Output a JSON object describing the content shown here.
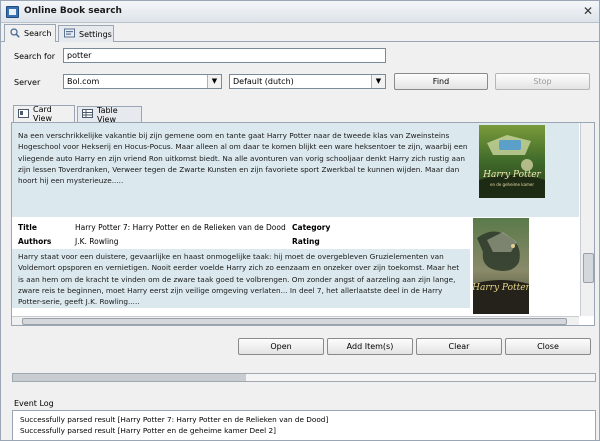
{
  "window": {
    "title": "Online Book search"
  },
  "tabs": [
    {
      "label": "Search"
    },
    {
      "label": "Settings"
    }
  ],
  "search": {
    "label": "Search for",
    "value": "potter"
  },
  "server": {
    "label": "Server",
    "value": "Bol.com",
    "locale": "Default (dutch)"
  },
  "buttons": {
    "find": "Find",
    "stop": "Stop",
    "open": "Open",
    "add": "Add Item(s)",
    "clear": "Clear",
    "close": "Close"
  },
  "view_tabs": [
    {
      "label": "Card View"
    },
    {
      "label": "Table View"
    }
  ],
  "results": [
    {
      "description": "Na een verschrikkelijke vakantie bij zijn gemene oom en tante gaat Harry Potter naar de tweede klas van Zweinsteins Hogeschool voor Hekserij en Hocus-Pocus. Maar alleen al om daar te komen blijkt een ware heksentoer te zijn, waarbij een vliegende auto Harry en zijn vriend Ron uitkomst biedt. Na alle avonturen van vorig schooljaar denkt Harry zich rustig aan zijn lessen Toverdranken, Verweer tegen de Zwarte Kunsten en zijn favoriete sport Zwerkbal te kunnen wijden. Maar dan hoort hij een mysterieuze.....",
      "cover_title": "Harry Potter",
      "cover_subtitle": "en de geheime kamer"
    },
    {
      "title_label": "Title",
      "title": "Harry Potter 7: Harry Potter en de Relieken van de Dood",
      "category_label": "Category",
      "authors_label": "Authors",
      "authors": "J.K. Rowling",
      "rating_label": "Rating",
      "description": "Harry staat voor een duistere, gevaarlijke en haast onmogelijke taak: hij moet de overgebleven Gruzielementen van Voldemort opsporen en vernietigen. Nooit eerder voelde Harry zich zo eenzaam en onzeker over zijn toekomst. Maar het is aan hem om de kracht te vinden om de zware taak goed te volbrengen. Om zonder angst of aarzeling aan zijn lange, zware reis te beginnen, moet Harry eerst zijn veilige omgeving verlaten... In deel 7, het allerlaatste deel in de Harry Potter-serie, geeft J.K. Rowling.....",
      "cover_title": "Harry Potter"
    }
  ],
  "progress": {
    "fraction": 0.4
  },
  "event_log": {
    "label": "Event Log",
    "entries": [
      "Successfully parsed result [Harry Potter 7: Harry Potter en de Relieken van de Dood]",
      "Successfully parsed result [Harry Potter en de geheime kamer Deel 2]"
    ]
  },
  "colors": {
    "card_highlight": "#dbe8ed",
    "border": "#9aa6b3",
    "accent": "#3a6fb0"
  }
}
